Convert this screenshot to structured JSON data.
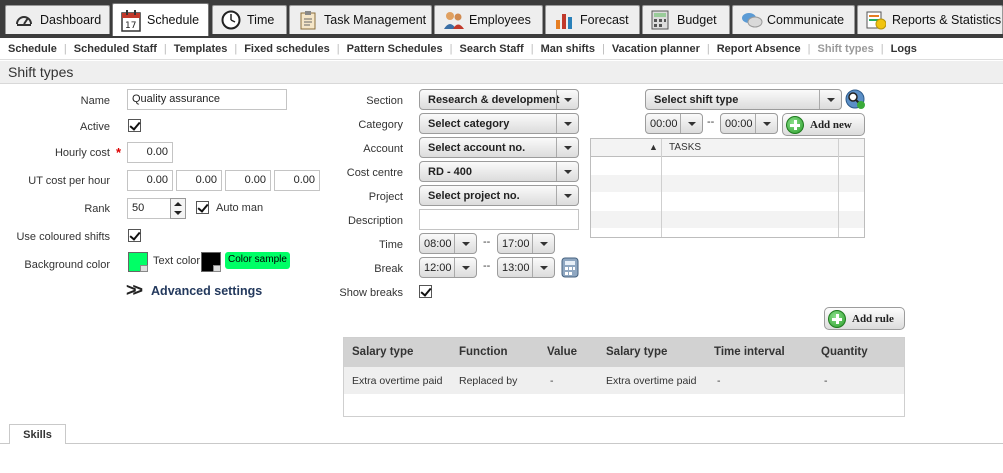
{
  "nav": {
    "tabs": [
      {
        "label": "Dashboard",
        "icon": "dashboard-gauge-icon"
      },
      {
        "label": "Schedule",
        "icon": "calendar-icon"
      },
      {
        "label": "Time",
        "icon": "clock-icon"
      },
      {
        "label": "Task Management",
        "icon": "clipboard-icon"
      },
      {
        "label": "Employees",
        "icon": "people-icon"
      },
      {
        "label": "Forecast",
        "icon": "bar-chart-icon"
      },
      {
        "label": "Budget",
        "icon": "calculator-icon"
      },
      {
        "label": "Communicate",
        "icon": "speech-bubbles-icon"
      },
      {
        "label": "Reports & Statistics",
        "icon": "report-icon"
      }
    ],
    "calendar_day": "17"
  },
  "submenu": [
    "Schedule",
    "Scheduled Staff",
    "Templates",
    "Fixed schedules",
    "Pattern Schedules",
    "Search Staff",
    "Man shifts",
    "Vacation planner",
    "Report Absence",
    "Shift types",
    "Logs"
  ],
  "page_title": "Shift types",
  "form": {
    "name_label": "Name",
    "name_value": "Quality assurance",
    "active_label": "Active",
    "hourly_cost_label": "Hourly cost",
    "hourly_cost_value": "0.00",
    "ut_cost_label": "UT cost per hour",
    "ut_costs": [
      "0.00",
      "0.00",
      "0.00",
      "0.00"
    ],
    "rank_label": "Rank",
    "rank_value": "50",
    "auto_man_label": "Auto man",
    "use_coloured_label": "Use coloured shifts",
    "bg_color_label": "Background color",
    "text_color_label": "Text color",
    "color_sample_label": "Color sample",
    "advanced_settings": "Advanced settings",
    "bg_color": "#00ff66",
    "text_color": "#000000",
    "required_marker": "*"
  },
  "middle": {
    "section_label": "Section",
    "section_value": "Research & development",
    "category_label": "Category",
    "category_value": "Select category",
    "account_label": "Account",
    "account_value": "Select account no.",
    "cost_centre_label": "Cost centre",
    "cost_centre_value": "RD - 400",
    "project_label": "Project",
    "project_value": "Select project no.",
    "description_label": "Description",
    "description_value": "",
    "time_label": "Time",
    "time_from": "08:00",
    "time_to": "17:00",
    "break_label": "Break",
    "break_from": "12:00",
    "break_to": "13:00",
    "show_breaks_label": "Show breaks",
    "range_sep": "--"
  },
  "right": {
    "shift_type_value": "Select shift type",
    "from_time": "00:00",
    "to_time": "00:00",
    "range_sep": "--",
    "add_new_label": "Add new",
    "tasks_header": "TASKS",
    "sort_indicator": "▲",
    "add_rule_label": "Add rule"
  },
  "rules": {
    "headers": [
      "Salary type",
      "Function",
      "Value",
      "Salary type",
      "Time interval",
      "Quantity"
    ],
    "rows": [
      [
        "Extra overtime paid",
        "Replaced by",
        "-",
        "Extra overtime paid",
        "-",
        "-"
      ]
    ]
  },
  "skills_tab": "Skills"
}
